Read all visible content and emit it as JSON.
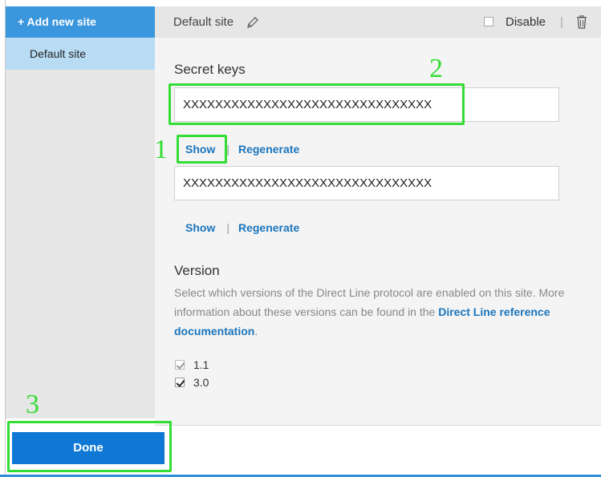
{
  "sidebar": {
    "add_site_label": "+ Add new site",
    "items": [
      {
        "label": "Default site"
      }
    ]
  },
  "header": {
    "site_name": "Default site",
    "disable_label": "Disable",
    "separator": "|"
  },
  "secret_keys": {
    "title": "Secret keys",
    "keys": [
      {
        "value": "XXXXXXXXXXXXXXXXXXXXXXXXXXXXXXX",
        "show_label": "Show",
        "regenerate_label": "Regenerate"
      },
      {
        "value": "XXXXXXXXXXXXXXXXXXXXXXXXXXXXXXX",
        "show_label": "Show",
        "regenerate_label": "Regenerate"
      }
    ],
    "link_separator": "|"
  },
  "version": {
    "title": "Version",
    "description_prefix": "Select which versions of the Direct Line protocol are enabled on this site. More information about these versions can be found in the ",
    "doc_link_label": "Direct Line reference documentation",
    "description_suffix": ".",
    "options": [
      {
        "label": "1.1",
        "checked": true,
        "disabled": true
      },
      {
        "label": "3.0",
        "checked": true,
        "disabled": false
      }
    ]
  },
  "footer": {
    "done_label": "Done"
  },
  "annotations": {
    "labels": [
      "1",
      "2",
      "3"
    ],
    "color": "#33dd33"
  },
  "colors": {
    "accent": "#0f78d4",
    "link": "#1b75bc",
    "selected_item": "#b9dcf5",
    "add_button": "#3a96dd"
  },
  "icons": {
    "edit": "pencil-icon",
    "delete": "trash-icon"
  }
}
